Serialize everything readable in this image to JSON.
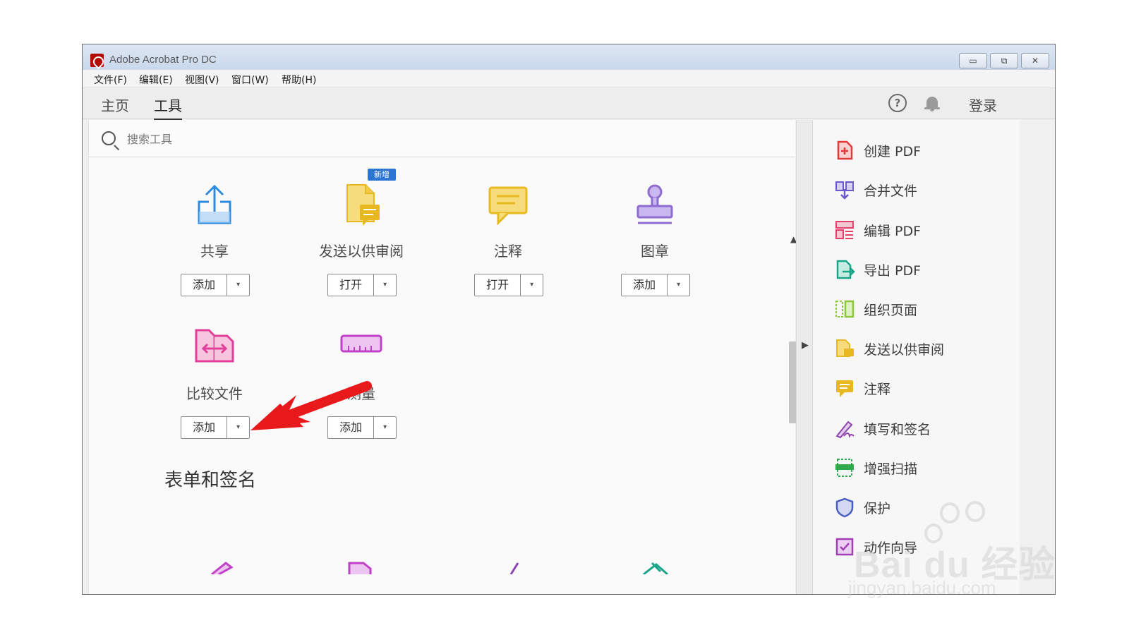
{
  "window": {
    "title": "Adobe Acrobat Pro DC",
    "controls": {
      "minimize": "▭",
      "restore": "⧉",
      "close": "✕"
    }
  },
  "menu": {
    "items": [
      {
        "label": "文件(F)"
      },
      {
        "label": "编辑(E)"
      },
      {
        "label": "视图(V)"
      },
      {
        "label": "窗口(W)"
      },
      {
        "label": "帮助(H)"
      }
    ]
  },
  "tabs": [
    {
      "label": "主页"
    },
    {
      "label": "工具"
    }
  ],
  "header": {
    "help": "?",
    "login": "登录"
  },
  "search": {
    "placeholder": "搜索工具"
  },
  "tools": [
    {
      "label": "共享",
      "button": "添加",
      "icon": "share-icon"
    },
    {
      "label": "发送以供审阅",
      "button": "打开",
      "icon": "send-for-review-icon",
      "badge": "新增"
    },
    {
      "label": "注释",
      "button": "打开",
      "icon": "comment-icon"
    },
    {
      "label": "图章",
      "button": "添加",
      "icon": "stamp-icon"
    },
    {
      "label": "比较文件",
      "button": "添加",
      "icon": "compare-files-icon"
    },
    {
      "label": "测量",
      "button": "添加",
      "icon": "measure-icon"
    }
  ],
  "dropdown_glyph": "▾",
  "section": {
    "title": "表单和签名"
  },
  "scroll": {
    "up": "▲",
    "down": "▼"
  },
  "collapse": "▶",
  "right_panel": {
    "items": [
      {
        "label": "创建 PDF",
        "icon": "create-pdf-icon",
        "color": "#e23a3a"
      },
      {
        "label": "合并文件",
        "icon": "combine-files-icon",
        "color": "#6a5acd"
      },
      {
        "label": "编辑 PDF",
        "icon": "edit-pdf-icon",
        "color": "#e0406a"
      },
      {
        "label": "导出 PDF",
        "icon": "export-pdf-icon",
        "color": "#1aa58a"
      },
      {
        "label": "组织页面",
        "icon": "organize-pages-icon",
        "color": "#8cc63f"
      },
      {
        "label": "发送以供审阅",
        "icon": "send-for-review-icon",
        "color": "#e8b820"
      },
      {
        "label": "注释",
        "icon": "comment-icon",
        "color": "#e8b820"
      },
      {
        "label": "填写和签名",
        "icon": "fill-sign-icon",
        "color": "#8e44ad"
      },
      {
        "label": "增强扫描",
        "icon": "enhance-scan-icon",
        "color": "#2eaa4a"
      },
      {
        "label": "保护",
        "icon": "protect-icon",
        "color": "#4a5fc1"
      },
      {
        "label": "动作向导",
        "icon": "action-wizard-icon",
        "color": "#a23fb5"
      }
    ]
  },
  "watermark": {
    "brand": "Bai du 经验",
    "url": "jingyan.baidu.com"
  },
  "colors": {
    "annotation_arrow": "#e8191b",
    "share": "#2d8be0",
    "review": "#e8b820",
    "stamp": "#8e6bd1",
    "compare": "#e0409a",
    "measure": "#c040c8",
    "badge": "#2d75d2"
  }
}
